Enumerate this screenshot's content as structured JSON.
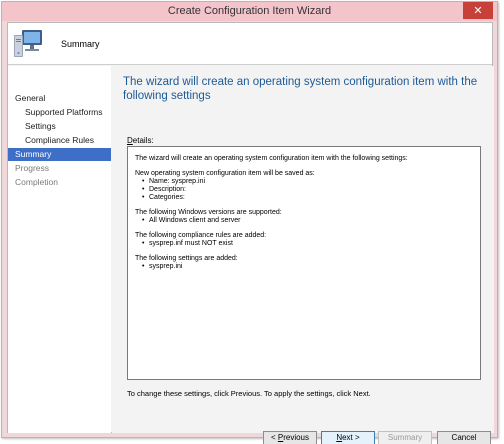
{
  "window": {
    "title": "Create Configuration Item Wizard",
    "close_glyph": "✕"
  },
  "header": {
    "title": "Summary",
    "icon": "computer-icon"
  },
  "nav": {
    "items": [
      {
        "label": "General"
      },
      {
        "label": "Supported Platforms"
      },
      {
        "label": "Settings"
      },
      {
        "label": "Compliance Rules"
      },
      {
        "label": "Summary"
      },
      {
        "label": "Progress"
      },
      {
        "label": "Completion"
      }
    ]
  },
  "content": {
    "title": "The wizard will create an operating system configuration item with the following settings",
    "details_label_hotkey": "D",
    "details_label_rest": "etails:",
    "details": {
      "intro": "The wizard will create an operating system configuration item with the following settings:",
      "saved_as": "New operating system configuration item will be saved as:",
      "name": "Name: sysprep.ini",
      "description": "Description:",
      "categories": "Categories:",
      "versions_heading": "The following Windows versions are supported:",
      "versions_item": "All Windows client and server",
      "rules_heading": "The following compliance rules are added:",
      "rules_item": "sysprep.inf must NOT exist",
      "settings_heading": "The following settings are added:",
      "settings_item": "sysprep.ini"
    },
    "hint": "To change these settings, click Previous. To apply the settings, click Next."
  },
  "buttons": {
    "previous_hotkey": "P",
    "previous_rest": "revious",
    "previous_prefix": "< ",
    "next_hotkey": "N",
    "next_rest": "ext >",
    "summary": "Summary",
    "cancel": "Cancel"
  }
}
